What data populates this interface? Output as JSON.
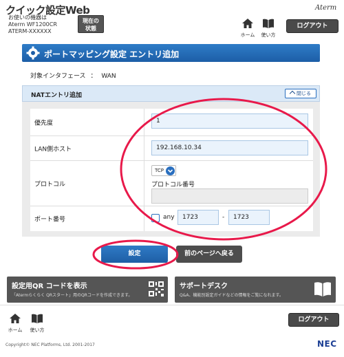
{
  "header": {
    "app_title": "クイック設定Web",
    "device_prefix": "お使いの機器は",
    "device_model": "Aterm WF1200CR",
    "device_serial": "ATERM-XXXXXX",
    "status_button": [
      "現在の",
      "状態"
    ],
    "brand_logo": "Aterm",
    "home_label": "ホーム",
    "guide_label": "使い方",
    "logout_label": "ログアウト"
  },
  "page": {
    "title": "ポートマッピング設定 エントリ追加",
    "interface_label": "対象インタフェース",
    "interface_sep": "：",
    "interface_value": "WAN"
  },
  "nat": {
    "section_title": "NATエントリ追加",
    "close_label": "閉じる",
    "priority_label": "優先度",
    "priority_value": "1",
    "lan_host_label": "LAN側ホスト",
    "lan_host_value": "192.168.10.34",
    "protocol_label": "プロトコル",
    "protocol_value": "TCP",
    "protocol_number_label": "プロトコル番号",
    "protocol_number_value": "",
    "port_label": "ポート番号",
    "any_label": "any",
    "any_checked": false,
    "port_from": "1723",
    "port_range_sep": "-",
    "port_to": "1723"
  },
  "actions": {
    "set_label": "設定",
    "back_label": "前のページへ戻る"
  },
  "banners": {
    "qr_title": "設定用QR コードを表示",
    "qr_desc": "「Atermらくらく QRスタート」用のQRコードを作成できます。",
    "support_title": "サポートデスク",
    "support_desc": "Q&A、機能別設定ガイドなどの情報をご覧になれます。"
  },
  "footer": {
    "home_label": "ホーム",
    "guide_label": "使い方",
    "logout_label": "ログアウト",
    "copyright": "Copyright© NEC Platforms, Ltd. 2001-2017",
    "nec_logo": "NEC"
  },
  "colors": {
    "accent_blue": "#1d5ea7",
    "annotation_red": "#e8194a",
    "dark_button": "#4d4d4d"
  }
}
